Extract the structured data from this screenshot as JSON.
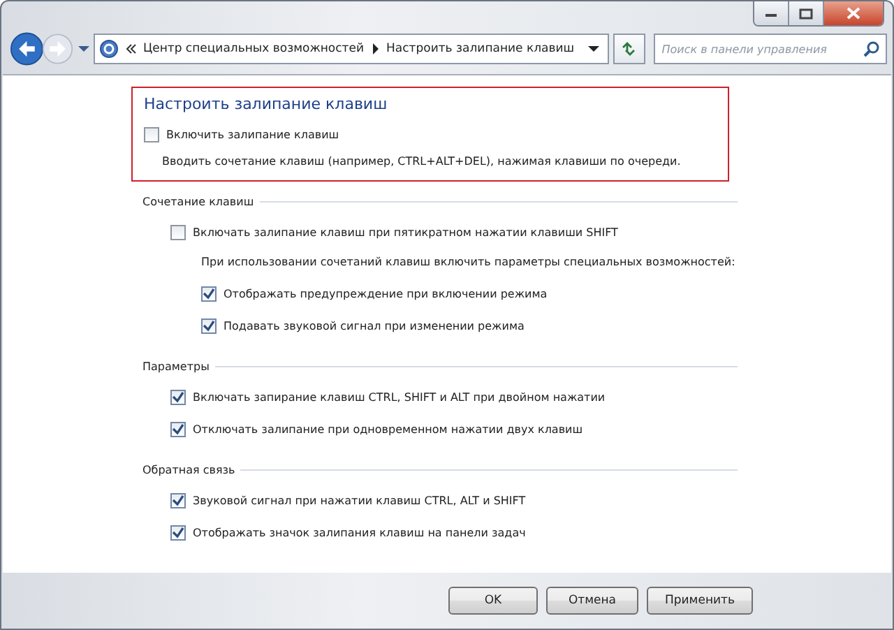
{
  "breadcrumb": [
    "Центр специальных возможностей",
    "Настроить залипание клавиш"
  ],
  "search": {
    "placeholder": "Поиск в панели управления"
  },
  "highlight": {
    "title": "Настроить залипание клавиш",
    "checkbox": {
      "label": "Включить залипание клавиш",
      "checked": false
    },
    "description": "Вводить сочетание клавиш (например, CTRL+ALT+DEL), нажимая клавиши по очереди."
  },
  "sections": [
    {
      "title": "Сочетание клавиш",
      "items": [
        {
          "kind": "checkbox",
          "label": "Включать залипание клавиш при пятикратном нажатии клавиши SHIFT",
          "checked": false,
          "children": [
            {
              "kind": "note",
              "label": "При использовании сочетаний клавиш включить параметры специальных возможностей:"
            },
            {
              "kind": "checkbox",
              "label": "Отображать предупреждение при включении режима",
              "checked": true
            },
            {
              "kind": "checkbox",
              "label": "Подавать звуковой сигнал при изменении режима",
              "checked": true
            }
          ]
        }
      ]
    },
    {
      "title": "Параметры",
      "items": [
        {
          "kind": "checkbox",
          "label": "Включать запирание клавиш CTRL, SHIFT и ALT при двойном нажатии",
          "checked": true
        },
        {
          "kind": "checkbox",
          "label": "Отключать залипание при одновременном нажатии двух клавиш",
          "checked": true
        }
      ]
    },
    {
      "title": "Обратная связь",
      "items": [
        {
          "kind": "checkbox",
          "label": "Звуковой сигнал при нажатии клавиш CTRL, ALT и SHIFT",
          "checked": true
        },
        {
          "kind": "checkbox",
          "label": "Отображать значок залипания клавиш на панели задач",
          "checked": true
        }
      ]
    }
  ],
  "buttons": [
    "OK",
    "Отмена",
    "Применить"
  ]
}
